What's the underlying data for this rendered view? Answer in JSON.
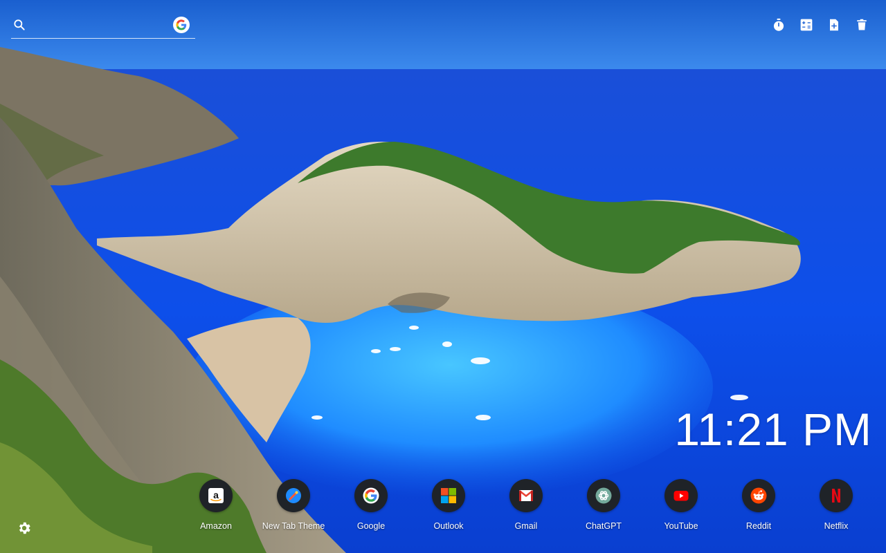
{
  "search": {
    "placeholder": "",
    "search_icon": "search-icon",
    "engine_icon": "google-icon"
  },
  "toolbar": {
    "items": [
      {
        "icon": "stopwatch-icon"
      },
      {
        "icon": "calculator-icon"
      },
      {
        "icon": "add-note-icon"
      },
      {
        "icon": "trash-icon"
      }
    ]
  },
  "clock": {
    "time": "11:21 PM"
  },
  "shortcuts": [
    {
      "label": "Amazon",
      "icon": "amazon-icon"
    },
    {
      "label": "New Tab Theme",
      "icon": "new-tab-theme-icon"
    },
    {
      "label": "Google",
      "icon": "google-icon"
    },
    {
      "label": "Outlook",
      "icon": "microsoft-icon"
    },
    {
      "label": "Gmail",
      "icon": "gmail-icon"
    },
    {
      "label": "ChatGPT",
      "icon": "chatgpt-icon"
    },
    {
      "label": "YouTube",
      "icon": "youtube-icon"
    },
    {
      "label": "Reddit",
      "icon": "reddit-icon"
    },
    {
      "label": "Netflix",
      "icon": "netflix-icon"
    }
  ],
  "settings": {
    "icon": "gear-icon"
  },
  "colors": {
    "sky": "#2a6fe0",
    "sea": "#1158e6",
    "shallow": "#2aa6ff",
    "cliff": "#cfc2a8",
    "vegetation": "#3f7f2e",
    "shortcut_bg": "#1f2328"
  }
}
